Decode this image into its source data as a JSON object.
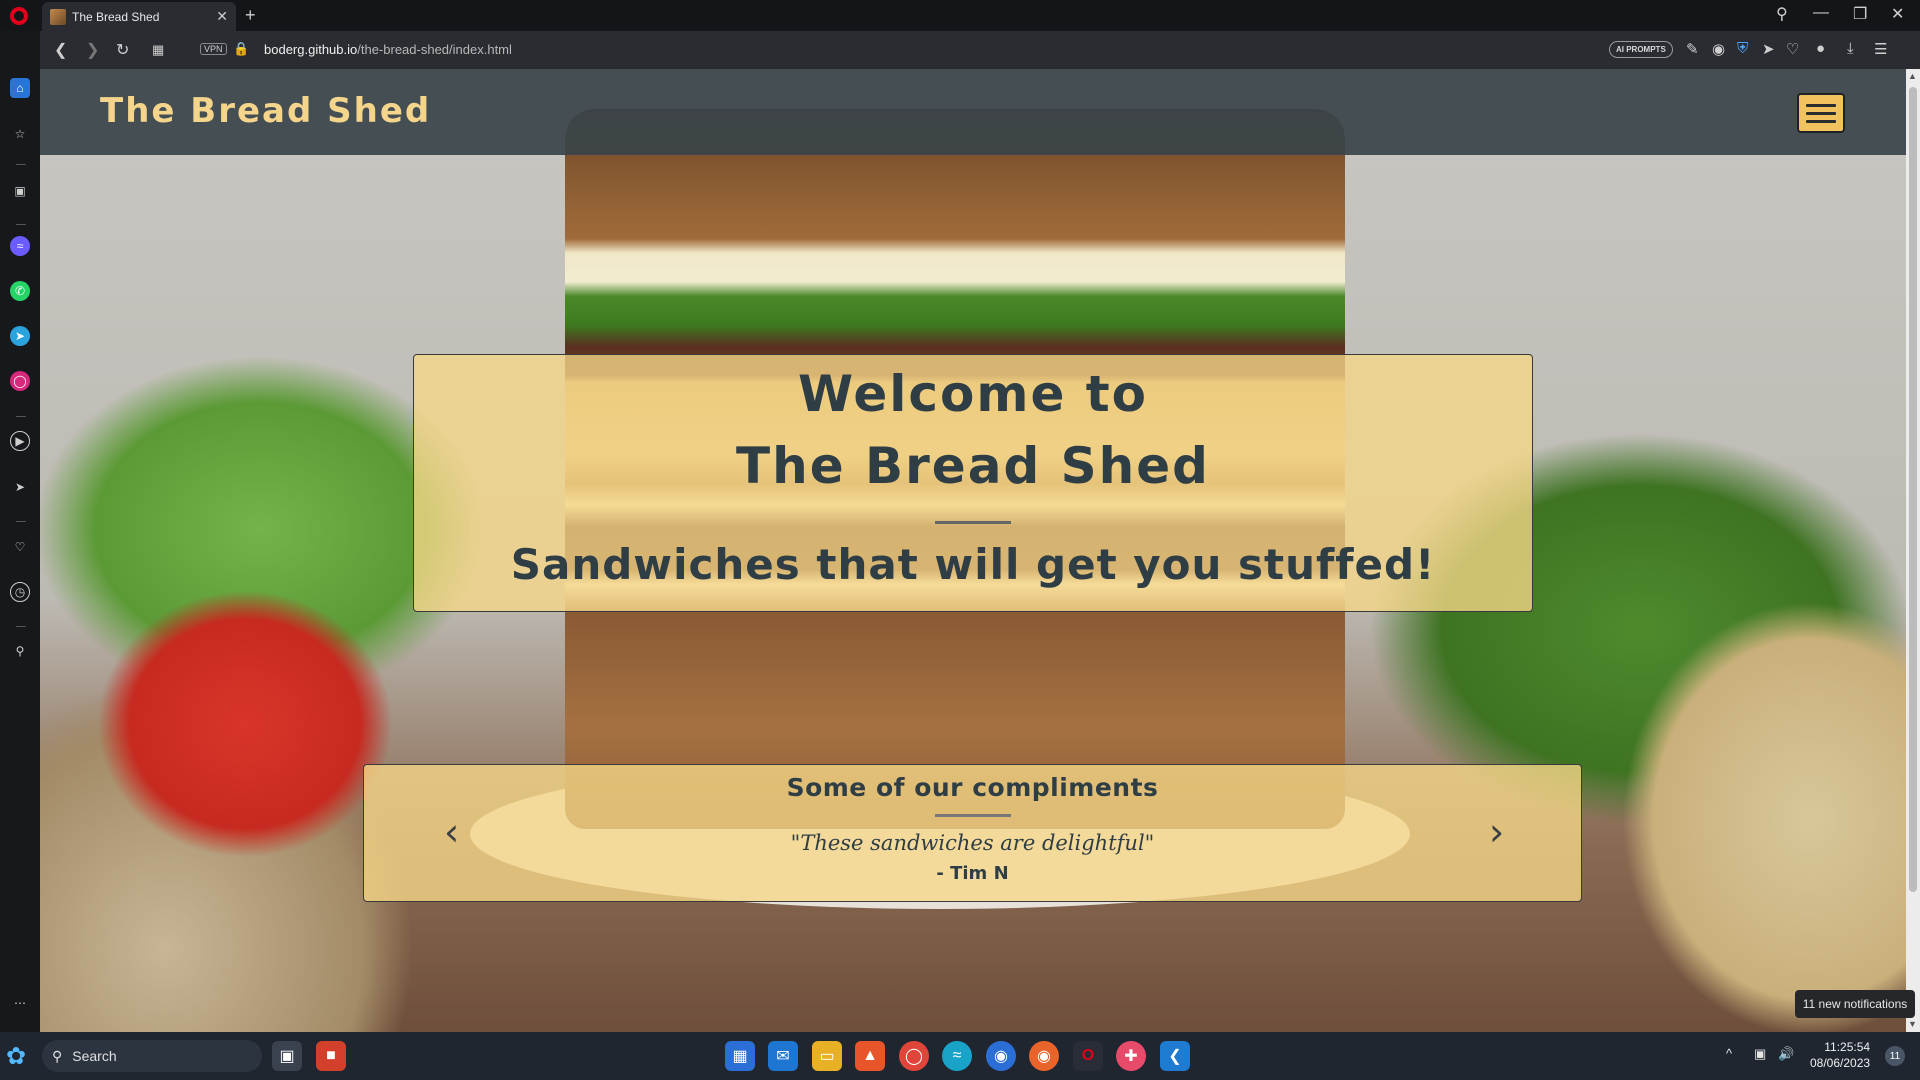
{
  "browser": {
    "tab_title": "The Bread Shed",
    "tab_close": "✕",
    "new_tab": "+",
    "url_host": "boderg.github.io",
    "url_path": "/the-bread-shed/index.html",
    "vpn_label": "VPN",
    "ai_prompts_label": "AI PROMPTS"
  },
  "site": {
    "logo": "The Bread Shed",
    "hero_line1": "Welcome to",
    "hero_line2": "The Bread Shed",
    "hero_subtitle": "Sandwiches that will get you stuffed!",
    "compliments_title": "Some of our compliments",
    "quote": "\"These sandwiches are delightful\"",
    "quote_author": "- Tim N",
    "prev_label": "‹",
    "next_label": "›"
  },
  "notifications": {
    "toast": "11 new notifications",
    "badge_count": "11"
  },
  "taskbar": {
    "search_label": "Search",
    "time": "11:25:54",
    "date": "08/06/2023"
  },
  "colors": {
    "header_bg": "#3a444a",
    "logo_text": "#f5d58c",
    "panel_bg": "#f6d788",
    "panel_text": "#2f3d45",
    "menu_button": "#f1c35e"
  }
}
